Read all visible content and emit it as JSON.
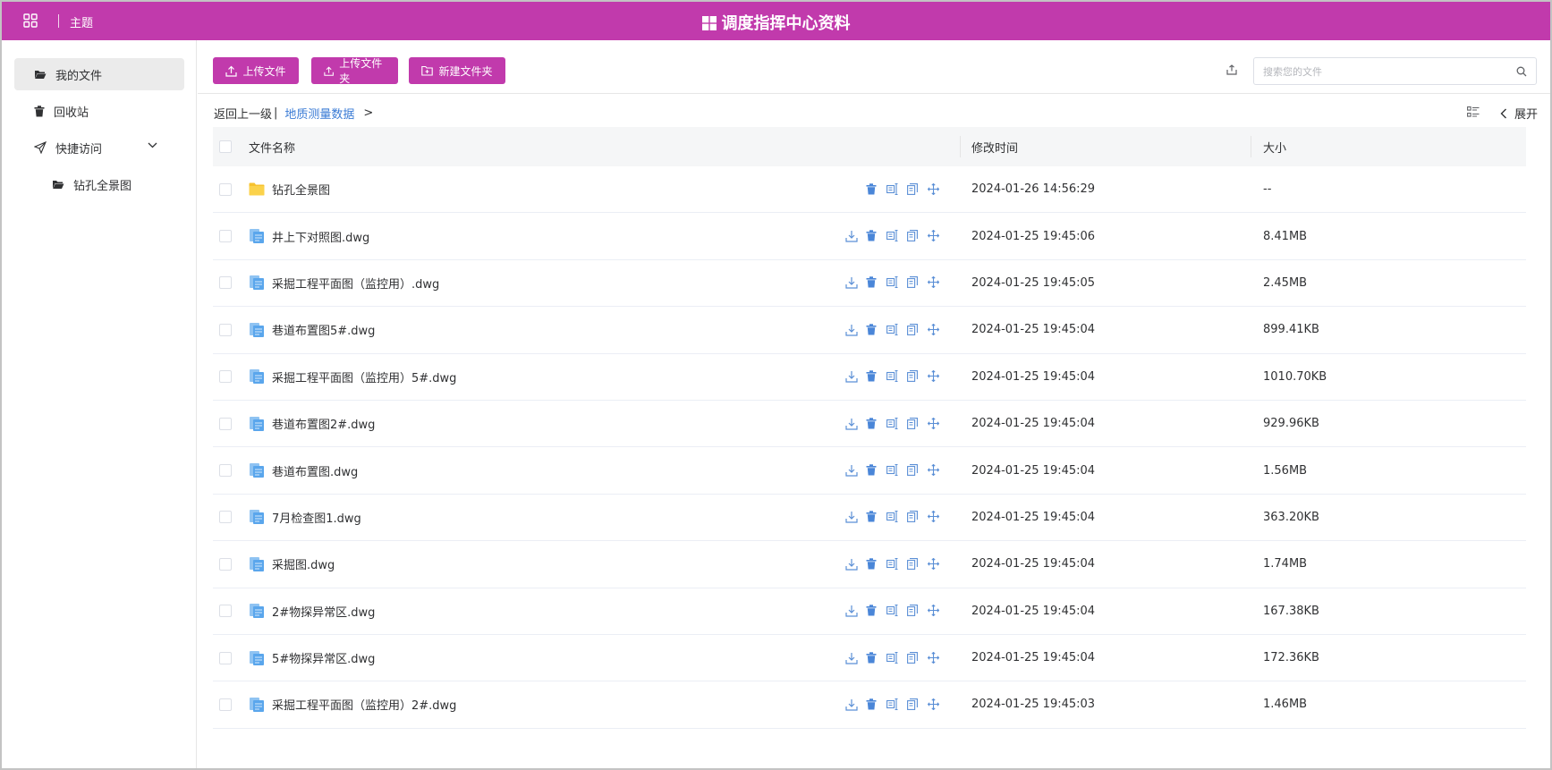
{
  "header": {
    "theme_label": "主题",
    "title": "调度指挥中心资料",
    "color": "#c13aac"
  },
  "sidebar": {
    "items": [
      {
        "label": "我的文件",
        "icon": "folder-open-icon",
        "active": true
      },
      {
        "label": "回收站",
        "icon": "trash-icon"
      },
      {
        "label": "快捷访问",
        "icon": "paper-plane-icon",
        "expandable": true
      },
      {
        "label": "钻孔全景图",
        "icon": "folder-open-icon"
      }
    ]
  },
  "toolbar": {
    "upload_file": "上传文件",
    "upload_folder": "上传文件夹",
    "new_folder": "新建文件夹"
  },
  "search": {
    "placeholder": "搜索您的文件"
  },
  "breadcrumb": {
    "back": "返回上一级",
    "separator": "|",
    "current": "地质测量数据",
    "arrow": ">"
  },
  "expand_label": "展开",
  "table": {
    "columns": {
      "name": "文件名称",
      "modified": "修改时间",
      "size": "大小"
    },
    "rows": [
      {
        "name": "钻孔全景图",
        "type": "folder",
        "modified": "2024-01-26 14:56:29",
        "size": "--"
      },
      {
        "name": "井上下对照图.dwg",
        "type": "file",
        "modified": "2024-01-25 19:45:06",
        "size": "8.41MB"
      },
      {
        "name": "采掘工程平面图（监控用）.dwg",
        "type": "file",
        "modified": "2024-01-25 19:45:05",
        "size": "2.45MB"
      },
      {
        "name": "巷道布置图5#.dwg",
        "type": "file",
        "modified": "2024-01-25 19:45:04",
        "size": "899.41KB"
      },
      {
        "name": "采掘工程平面图（监控用）5#.dwg",
        "type": "file",
        "modified": "2024-01-25 19:45:04",
        "size": "1010.70KB"
      },
      {
        "name": "巷道布置图2#.dwg",
        "type": "file",
        "modified": "2024-01-25 19:45:04",
        "size": "929.96KB"
      },
      {
        "name": "巷道布置图.dwg",
        "type": "file",
        "modified": "2024-01-25 19:45:04",
        "size": "1.56MB"
      },
      {
        "name": "7月检查图1.dwg",
        "type": "file",
        "modified": "2024-01-25 19:45:04",
        "size": "363.20KB"
      },
      {
        "name": "采掘图.dwg",
        "type": "file",
        "modified": "2024-01-25 19:45:04",
        "size": "1.74MB"
      },
      {
        "name": "2#物探异常区.dwg",
        "type": "file",
        "modified": "2024-01-25 19:45:04",
        "size": "167.38KB"
      },
      {
        "name": "5#物探异常区.dwg",
        "type": "file",
        "modified": "2024-01-25 19:45:04",
        "size": "172.36KB"
      },
      {
        "name": "采掘工程平面图（监控用）2#.dwg",
        "type": "file",
        "modified": "2024-01-25 19:45:03",
        "size": "1.46MB"
      }
    ]
  }
}
